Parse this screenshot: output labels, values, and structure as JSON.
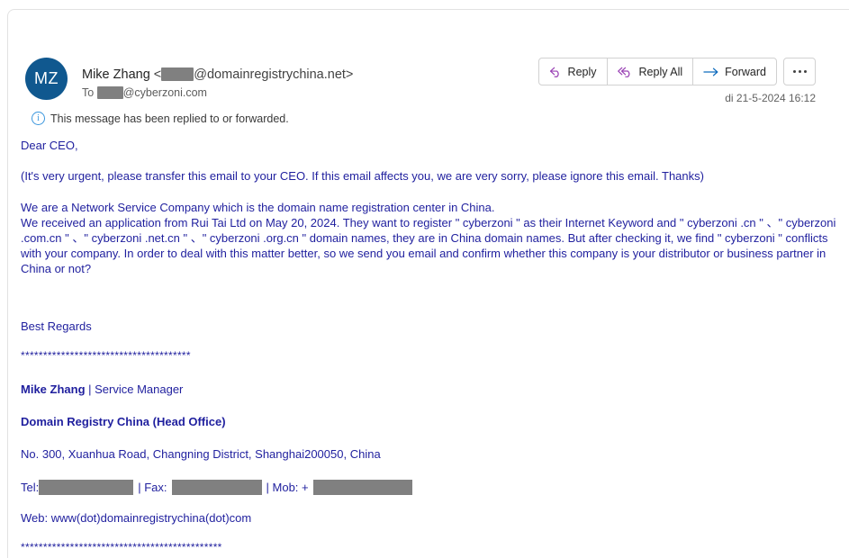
{
  "header": {
    "avatar_initials": "MZ",
    "avatar_color": "#10588f",
    "sender_name": "Mike Zhang",
    "sender_open_bracket": " <",
    "sender_domain": "@domainregistrychina.net>",
    "to_label": "To",
    "to_domain": "@cyberzoni.com",
    "info_notice": "This message has been replied to or forwarded.",
    "timestamp": "di 21-5-2024 16:12"
  },
  "toolbar": {
    "reply_label": "Reply",
    "reply_all_label": "Reply All",
    "forward_label": "Forward",
    "overflow_label": "More actions",
    "reply_icon_color": "#9a42b5",
    "forward_icon_color": "#0f6cbd"
  },
  "message": {
    "text_color": "#1f1f9e",
    "greeting": "Dear CEO,",
    "urgent_note": "(It's very urgent, please transfer this email to your CEO. If this email affects you, we are very sorry, please ignore this email. Thanks)",
    "para_line_1": "We are a Network Service Company which is the domain name registration center in China.",
    "para_line_2": "We received an application from Rui Tai Ltd on May 20, 2024. They want to register \" cyberzoni \" as their Internet Keyword and \" cyberzoni .cn \" 、\" cyberzoni .com.cn \" 、\" cyberzoni .net.cn \" 、\" cyberzoni .org.cn \" domain names, they are in China domain names. But after checking it, we find \" cyberzoni \" conflicts with your company. In order to deal with this matter better, so we send you email and confirm whether this company is your distributor or business partner in China or not?",
    "closing": "Best Regards",
    "star_line_top": "**************************************",
    "signature_name": "Mike Zhang",
    "signature_title": " | Service Manager",
    "company": "Domain Registry China (Head Office)",
    "address": "No. 300, Xuanhua Road, Changning District, Shanghai200050, China",
    "tel_label": "Tel:",
    "fax_label": "| Fax: ",
    "mob_label": "| Mob: +",
    "web": "Web: www(dot)domainregistrychina(dot)com",
    "star_line_bottom": "*********************************************"
  }
}
